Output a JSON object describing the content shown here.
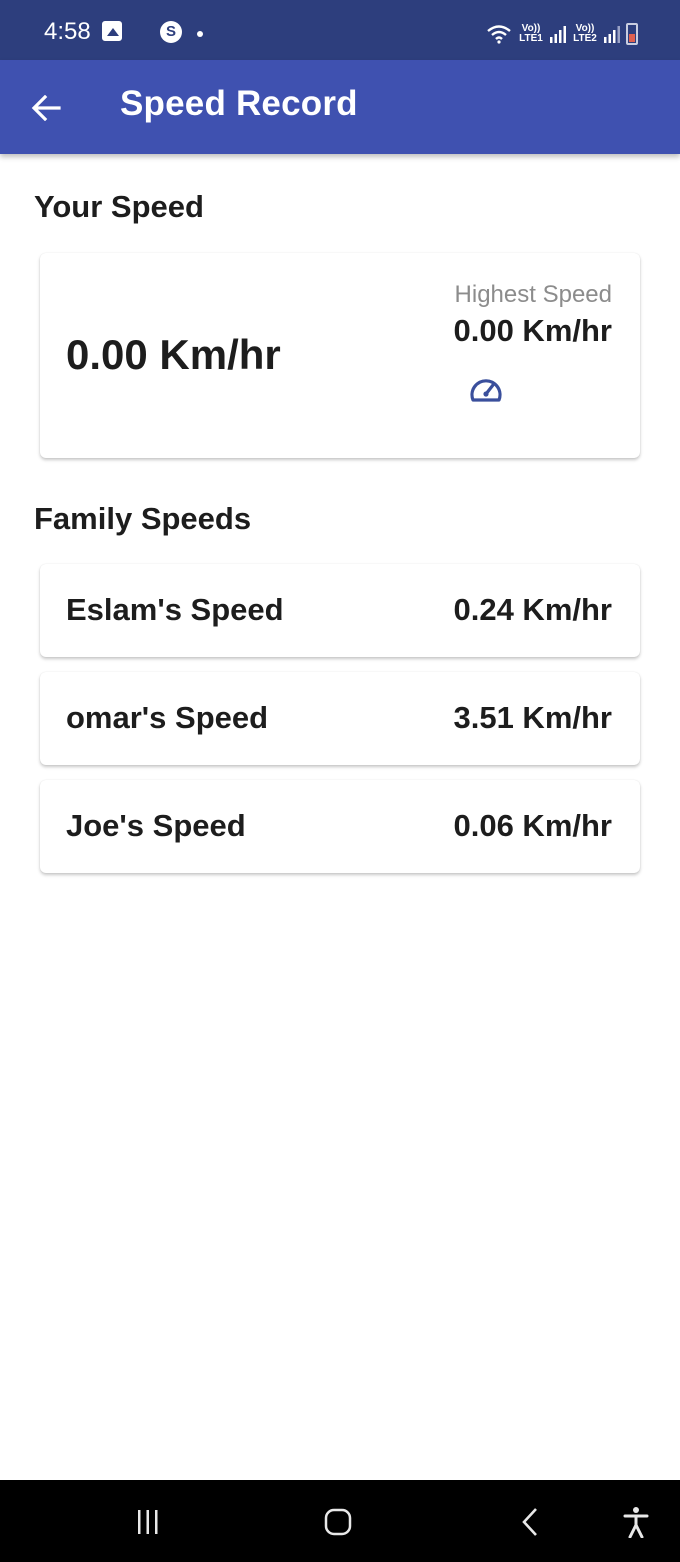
{
  "status_bar": {
    "time": "4:58",
    "sim1_label": "Vo)) LTE1",
    "sim2_label": "Vo)) LTE2",
    "left_icons": [
      "image-icon",
      "s-app-icon",
      "dot-icon"
    ],
    "right_icons": [
      "wifi-icon",
      "signal-icon",
      "signal-icon",
      "battery-icon"
    ]
  },
  "app_bar": {
    "title": "Speed Record",
    "back_icon": "arrow-left-icon",
    "color": "#3f51b0"
  },
  "your_speed": {
    "heading": "Your Speed",
    "current": "0.00 Km/hr",
    "highest_label": "Highest Speed",
    "highest_value": "0.00 Km/hr",
    "icon": "speedometer-icon",
    "icon_color": "#3a4f9c"
  },
  "family": {
    "heading": "Family Speeds",
    "members": [
      {
        "name": "Eslam's Speed",
        "speed": "0.24 Km/hr"
      },
      {
        "name": "omar's Speed",
        "speed": "3.51 Km/hr"
      },
      {
        "name": "Joe's Speed",
        "speed": "0.06 Km/hr"
      }
    ]
  },
  "nav_bar": {
    "icons": [
      "recent-apps-icon",
      "home-icon",
      "back-icon",
      "accessibility-icon"
    ]
  }
}
